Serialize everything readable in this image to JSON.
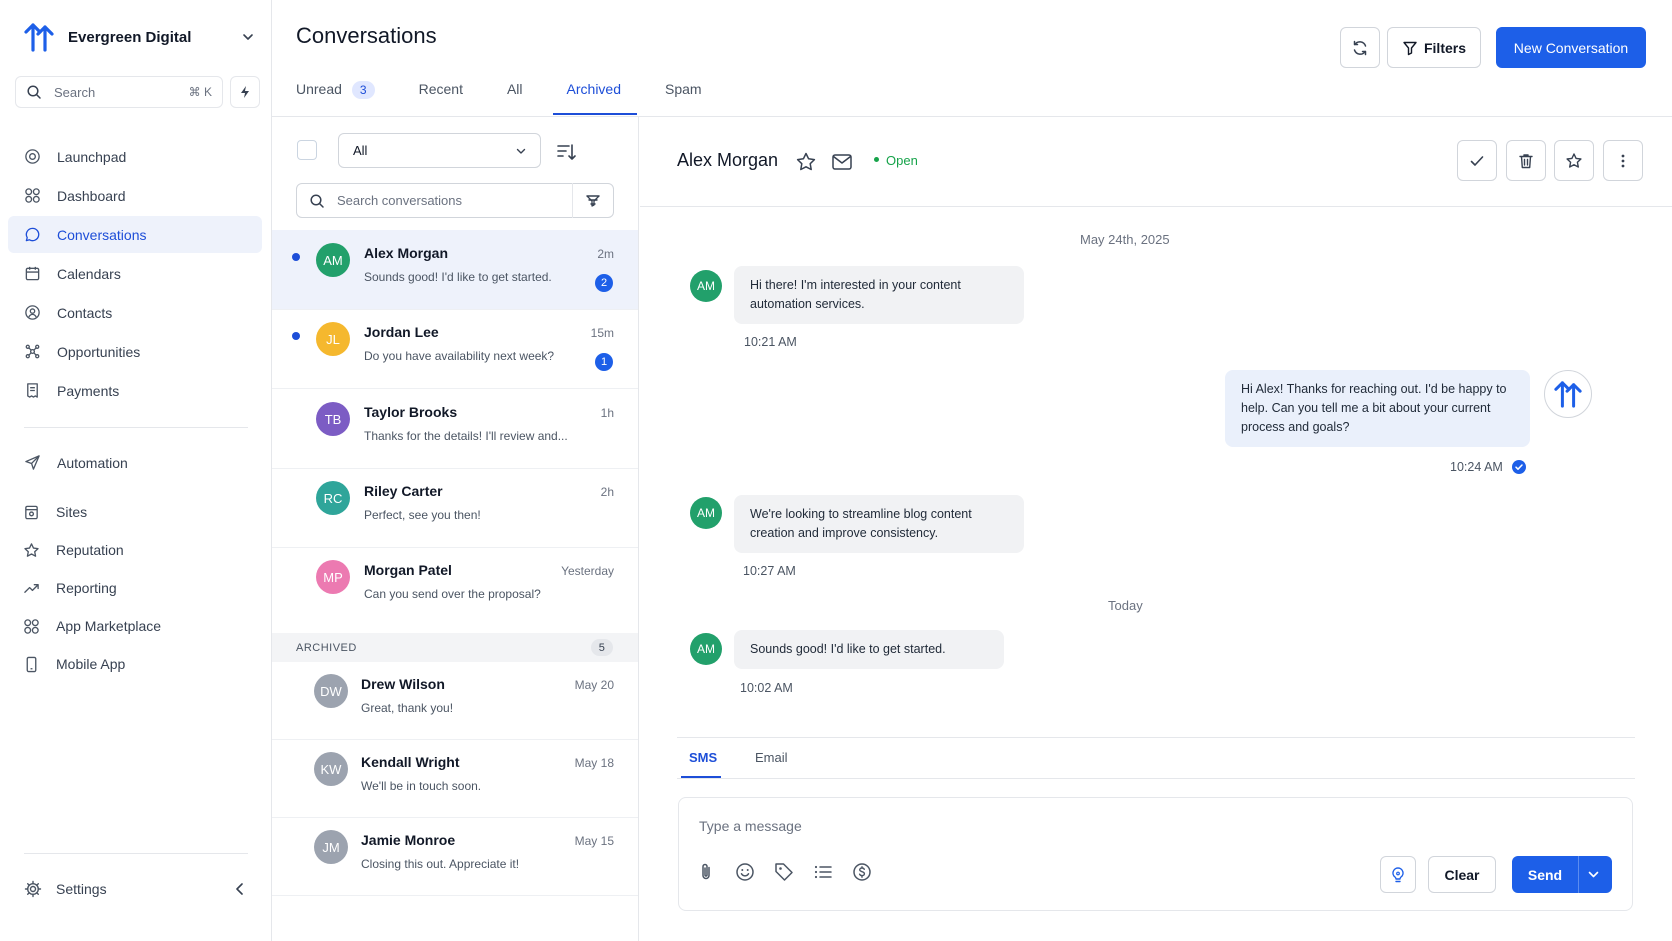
{
  "colors": {
    "accent": "#1d5fe8",
    "online": "#16a34a"
  },
  "sidebar": {
    "workspace": "Evergreen Digital",
    "search": {
      "placeholder": "Search",
      "shortcut": "⌘ K"
    },
    "nav_primary": [
      {
        "label": "Launchpad",
        "icon": "target-icon"
      },
      {
        "label": "Dashboard",
        "icon": "grid-icon"
      },
      {
        "label": "Conversations",
        "icon": "chat-bubble-icon",
        "active": true
      },
      {
        "label": "Calendars",
        "icon": "calendar-icon"
      },
      {
        "label": "Contacts",
        "icon": "contact-icon"
      },
      {
        "label": "Opportunities",
        "icon": "network-icon"
      },
      {
        "label": "Payments",
        "icon": "receipt-icon"
      }
    ],
    "nav_secondary": [
      {
        "label": "Automation",
        "icon": "send-icon"
      }
    ],
    "nav_tertiary": [
      {
        "label": "Sites",
        "icon": "browser-icon"
      },
      {
        "label": "Reputation",
        "icon": "star-icon"
      },
      {
        "label": "Reporting",
        "icon": "trend-icon"
      },
      {
        "label": "App Marketplace",
        "icon": "apps-icon"
      },
      {
        "label": "Mobile App",
        "icon": "phone-icon"
      }
    ],
    "settings_label": "Settings"
  },
  "header": {
    "title": "Conversations",
    "tabs": [
      {
        "label": "Unread",
        "count": "3"
      },
      {
        "label": "Recent"
      },
      {
        "label": "All"
      },
      {
        "label": "Archived",
        "active": true
      },
      {
        "label": "Spam"
      }
    ],
    "filters_label": "Filters",
    "new_label": "New Conversation"
  },
  "list": {
    "filter_value": "All",
    "search_placeholder": "Search conversations",
    "conversations": [
      {
        "initials": "AM",
        "name": "Alex Morgan",
        "preview": "Sounds good! I'd like to get started.",
        "time": "2m",
        "unread": "2",
        "color": "#22a06b",
        "selected": true,
        "dot": true
      },
      {
        "initials": "JL",
        "name": "Jordan Lee",
        "preview": "Do you have availability next week?",
        "time": "15m",
        "unread": "1",
        "color": "#f5b82e",
        "dot": true
      },
      {
        "initials": "TB",
        "name": "Taylor Brooks",
        "preview": "Thanks for the details! I'll review and...",
        "time": "1h",
        "color": "#7c5cc4"
      },
      {
        "initials": "RC",
        "name": "Riley Carter",
        "preview": "Perfect, see you then!",
        "time": "2h",
        "color": "#2fa59a"
      },
      {
        "initials": "MP",
        "name": "Morgan Patel",
        "preview": "Can you send over the proposal?",
        "time": "Yesterday",
        "color": "#ec7ab1"
      }
    ],
    "archived_label": "ARCHIVED",
    "archived_count": "5",
    "archived": [
      {
        "initials": "DW",
        "name": "Drew Wilson",
        "preview": "Great, thank you!",
        "time": "May 20"
      },
      {
        "initials": "KW",
        "name": "Kendall Wright",
        "preview": "We'll be in touch soon.",
        "time": "May 18"
      },
      {
        "initials": "JM",
        "name": "Jamie Monroe",
        "preview": "Closing this out. Appreciate it!",
        "time": "May 15"
      }
    ]
  },
  "chat": {
    "contact_name": "Alex Morgan",
    "status": "Open",
    "date_1": "May 24th, 2025",
    "date_2": "Today",
    "messages": [
      {
        "initials": "AM",
        "text": "Hi there! I'm interested in your content automation services.",
        "time": "10:21 AM"
      },
      {
        "text": "Hi Alex! Thanks for reaching out. I'd be happy to help. Can you tell me a bit about your current process and goals?",
        "time": "10:24 AM"
      },
      {
        "initials": "AM",
        "text": "We're looking to streamline blog content creation and improve consistency.",
        "time": "10:27 AM"
      },
      {
        "initials": "AM",
        "text": "Sounds good! I'd like to get started.",
        "time": "10:02 AM"
      }
    ],
    "composer": {
      "tabs": [
        {
          "label": "SMS",
          "active": true
        },
        {
          "label": "Email"
        }
      ],
      "placeholder": "Type a message",
      "clear_label": "Clear",
      "send_label": "Send"
    }
  }
}
